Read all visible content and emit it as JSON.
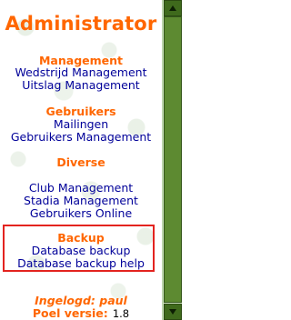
{
  "menu": {
    "title": "Administrator",
    "sections": [
      {
        "heading": "Management",
        "items": [
          "Wedstrijd Management",
          "Uitslag Management"
        ]
      },
      {
        "heading": "Gebruikers",
        "items": [
          "Mailingen",
          "Gebruikers Management"
        ]
      },
      {
        "heading": "Diverse",
        "items": [
          "Club Management",
          "Stadia Management",
          "Gebruikers Online"
        ]
      },
      {
        "heading": "Backup",
        "items": [
          "Database backup",
          "Database backup help"
        ]
      }
    ]
  },
  "status": {
    "logged_in": "Ingelogd: paul",
    "version_label": "Poel versie:",
    "version_value": "1.8"
  },
  "colors": {
    "heading": "#ff6600",
    "link": "#000099",
    "highlight_border": "#e3231f",
    "scrollbar": "#3f6a1c"
  }
}
